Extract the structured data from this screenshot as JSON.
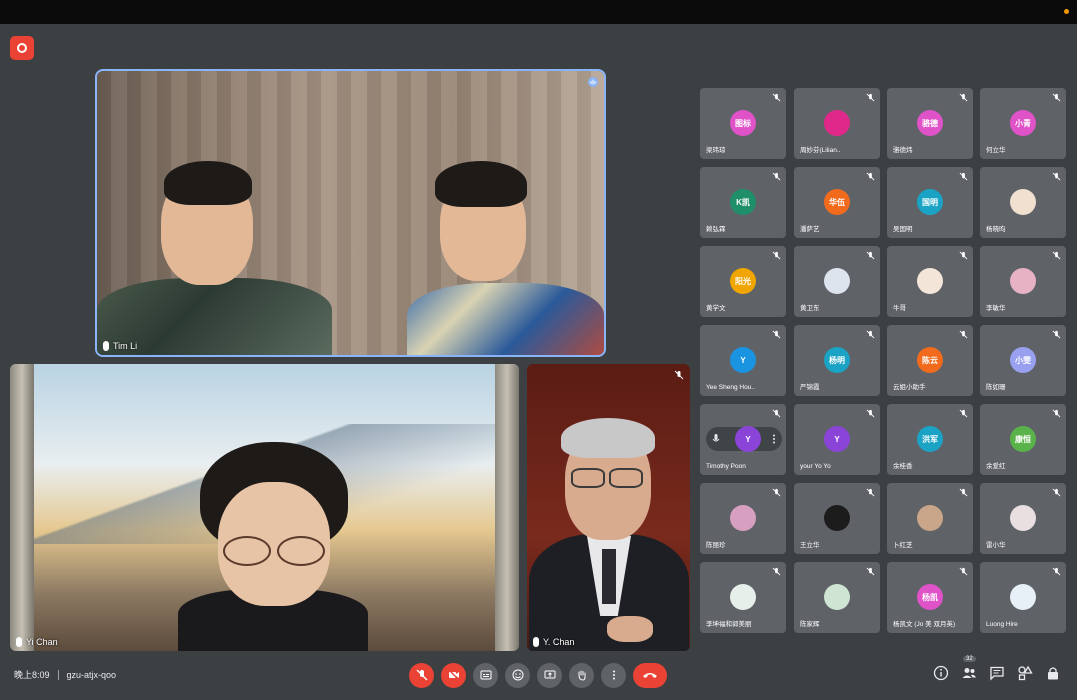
{
  "meeting": {
    "time": "晚上8:09",
    "code": "gzu-atjx-qoo",
    "colors": {
      "background": "#3c4043",
      "tile": "#5f6368",
      "accent": "#8ab4f8",
      "danger": "#ea4335"
    }
  },
  "main_tiles": [
    {
      "name": "Tim Li",
      "speaking": true
    },
    {
      "name": "Yi Chan",
      "speaking": false
    },
    {
      "name": "Y. Chan",
      "speaking": false
    }
  ],
  "participants": [
    {
      "name": "梁玮琼",
      "avatar": "图标",
      "color": "#e052c8"
    },
    {
      "name": "周妙芬(Lilian..",
      "avatar": "",
      "color": "#e0288a"
    },
    {
      "name": "骆德炜",
      "avatar": "骆德",
      "color": "#e052c8"
    },
    {
      "name": "何立华",
      "avatar": "小青",
      "color": "#e052c8"
    },
    {
      "name": "赖弘霖",
      "avatar": "K凯",
      "color": "#1f8f6a"
    },
    {
      "name": "潘萨艺",
      "avatar": "华伍",
      "color": "#f26b1d"
    },
    {
      "name": "吴国明",
      "avatar": "国明",
      "color": "#1aa3c4"
    },
    {
      "name": "杨晓昀",
      "avatar": "",
      "color": "#f1e0d0"
    },
    {
      "name": "黄学文",
      "avatar": "阳光",
      "color": "#f0a500"
    },
    {
      "name": "黄卫东",
      "avatar": "",
      "color": "#dde4ee"
    },
    {
      "name": "牛哥",
      "avatar": "",
      "color": "#f3e6d8"
    },
    {
      "name": "李敏华",
      "avatar": "",
      "color": "#e7b3c4"
    },
    {
      "name": "Yee Sheng Hou..",
      "avatar": "Y",
      "color": "#1a93e0"
    },
    {
      "name": "严锦霞",
      "avatar": "杨明",
      "color": "#1aa3c4"
    },
    {
      "name": "云姐小助手",
      "avatar": "陈云",
      "color": "#f26b1d"
    },
    {
      "name": "陈如珊",
      "avatar": "小雯",
      "color": "#9aa0f0"
    },
    {
      "name": "Timothy Poon",
      "avatar": "Y",
      "color": "#8a45d8"
    },
    {
      "name": "your Yo Yo",
      "avatar": "Y",
      "color": "#8a45d8"
    },
    {
      "name": "余桂香",
      "avatar": "洪军",
      "color": "#1aa3c4"
    },
    {
      "name": "余爱红",
      "avatar": "康恒",
      "color": "#5ab34a"
    },
    {
      "name": "陈丽珍",
      "avatar": "",
      "color": "#d8a0c0"
    },
    {
      "name": "王立华",
      "avatar": "",
      "color": "#1c1c1c"
    },
    {
      "name": "卜红芝",
      "avatar": "",
      "color": "#c9a58a"
    },
    {
      "name": "雷小华",
      "avatar": "",
      "color": "#e9dfe0"
    },
    {
      "name": "李坤福和郭美丽",
      "avatar": "",
      "color": "#e6efe9"
    },
    {
      "name": "陈家辉",
      "avatar": "",
      "color": "#cfe4d3"
    },
    {
      "name": "杨凯文 (Jo 美 双月英)",
      "avatar": "杨凯",
      "color": "#e052c8"
    },
    {
      "name": "Luong Hire",
      "avatar": "",
      "color": "#e6f0f6"
    }
  ]
}
